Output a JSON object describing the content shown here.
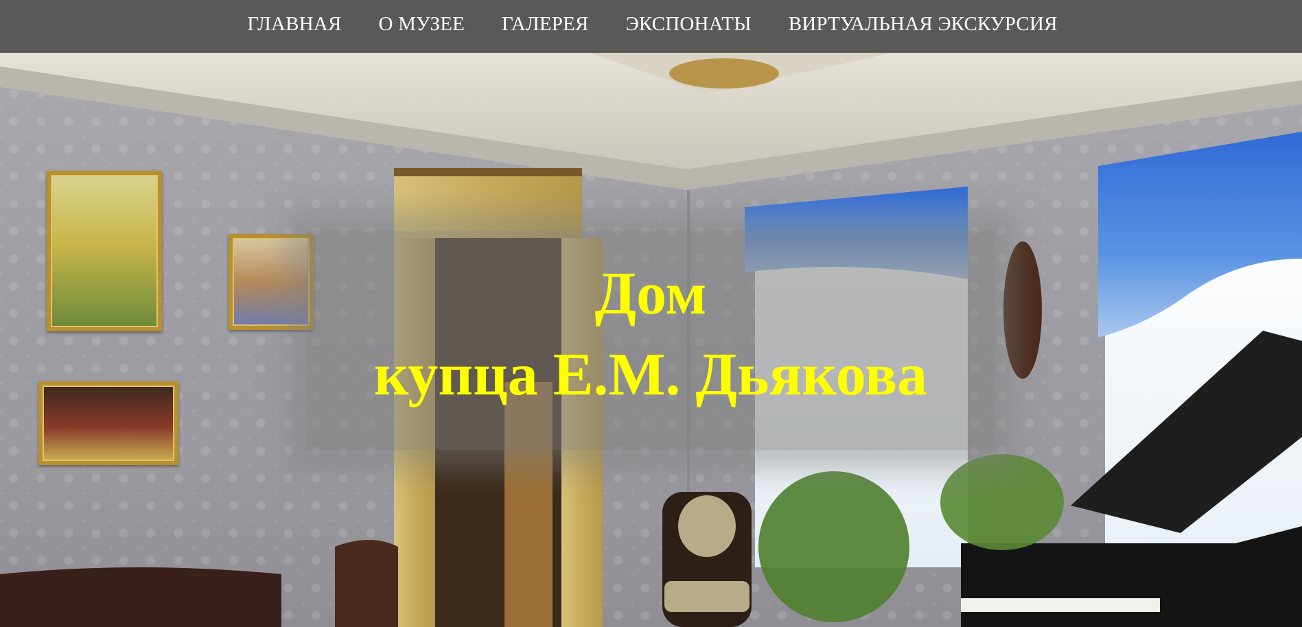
{
  "nav": {
    "items": [
      {
        "label": "ГЛАВНАЯ"
      },
      {
        "label": "О МУЗЕЕ"
      },
      {
        "label": "ГАЛЕРЕЯ"
      },
      {
        "label": "ЭКСПОНАТЫ"
      },
      {
        "label": "ВИРТУАЛЬНАЯ ЭКСКУРСИЯ"
      }
    ]
  },
  "hero": {
    "title_line1": "Дом",
    "title_line2": "купца Е.М. Дьякова",
    "title_color": "#ffff00"
  },
  "colors": {
    "navbar_bg": "#5b5858",
    "nav_text": "#ffffff",
    "curtain_blue": "#4a7fd6",
    "frame_gold": "#b8902e"
  }
}
